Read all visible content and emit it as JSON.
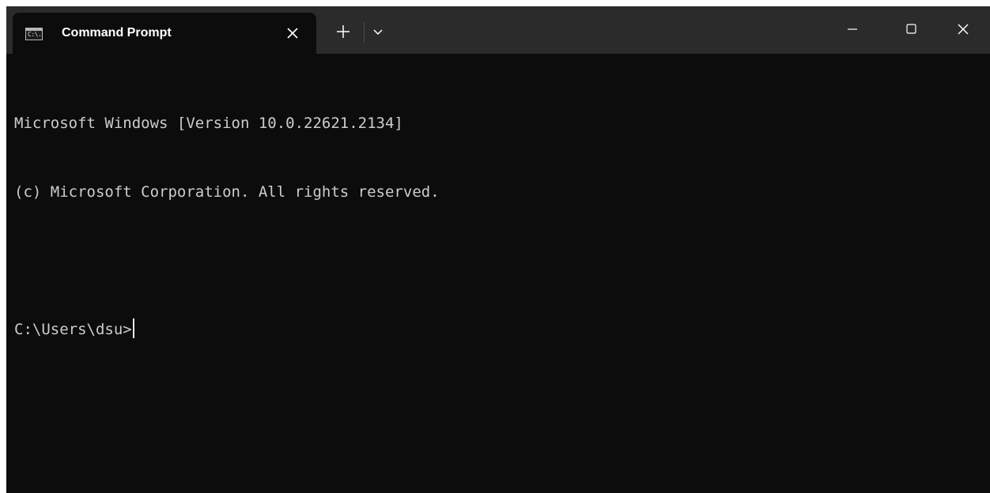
{
  "window": {
    "tab_title": "Command Prompt",
    "tab_icon_text": "C:\\."
  },
  "console": {
    "lines": [
      "Microsoft Windows [Version 10.0.22621.2134]",
      "(c) Microsoft Corporation. All rights reserved.",
      "",
      "C:\\Users\\dsu>"
    ]
  },
  "icons": {
    "tab_icon": "command-prompt-icon",
    "tab_close": "close-icon",
    "new_tab": "plus-icon",
    "dropdown": "chevron-down-icon",
    "minimize": "minimize-icon",
    "maximize": "maximize-icon",
    "close": "close-icon"
  },
  "colors": {
    "console_bg": "#0c0c0c",
    "titlebar_bg": "#2b2b2b",
    "console_text": "#cccccc"
  }
}
